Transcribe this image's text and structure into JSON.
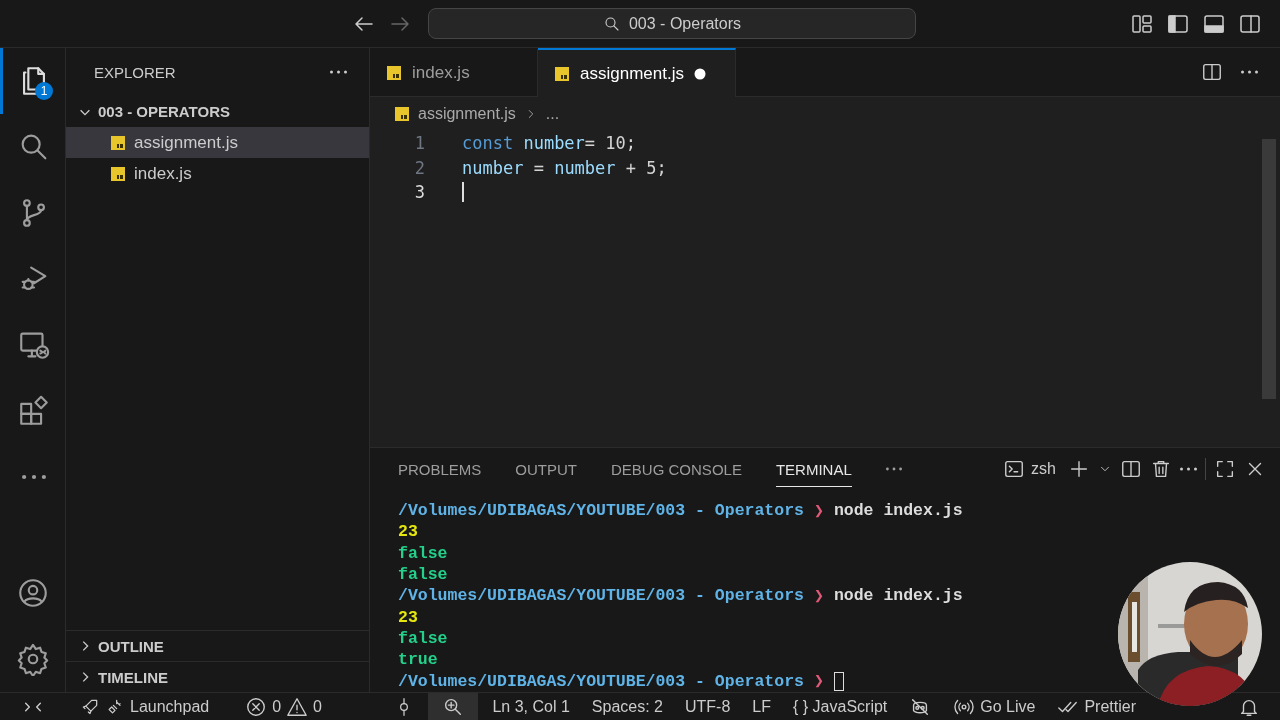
{
  "title_bar": {
    "search": "003 - Operators"
  },
  "activity_bar": {
    "items": [
      {
        "kind": "explorer",
        "selected": true,
        "badge": "1"
      },
      {
        "kind": "search",
        "selected": false
      },
      {
        "kind": "source-control",
        "selected": false
      },
      {
        "kind": "run-debug",
        "selected": false
      },
      {
        "kind": "remote",
        "selected": false
      },
      {
        "kind": "extensions",
        "selected": false
      },
      {
        "kind": "more",
        "selected": false
      }
    ],
    "bottom": [
      {
        "kind": "account"
      },
      {
        "kind": "settings"
      }
    ]
  },
  "sidebar": {
    "title": "EXPLORER",
    "folder": {
      "label": "003 - OPERATORS",
      "expanded": true,
      "children": [
        {
          "label": "assignment.js",
          "selected": true
        },
        {
          "label": "index.js",
          "selected": false
        }
      ]
    },
    "sections": [
      {
        "label": "OUTLINE",
        "expanded": false
      },
      {
        "label": "TIMELINE",
        "expanded": false
      }
    ]
  },
  "editor": {
    "tabs": [
      {
        "label": "index.js",
        "selected": false,
        "modified": false
      },
      {
        "label": "assignment.js",
        "selected": true,
        "modified": true
      }
    ],
    "breadcrumb": [
      "assignment.js",
      "..."
    ],
    "lines": [
      {
        "number": "1",
        "current": false,
        "cursor": false,
        "tokens": [
          {
            "kind": "keyword",
            "text": "const "
          },
          {
            "kind": "variable",
            "text": "number"
          },
          {
            "kind": "plain",
            "text": "= 10;"
          }
        ]
      },
      {
        "number": "2",
        "current": false,
        "cursor": false,
        "tokens": [
          {
            "kind": "variable",
            "text": "number"
          },
          {
            "kind": "plain",
            "text": " = "
          },
          {
            "kind": "variable",
            "text": "number"
          },
          {
            "kind": "plain",
            "text": " + 5;"
          }
        ]
      },
      {
        "number": "3",
        "current": true,
        "cursor": true
      }
    ]
  },
  "panel": {
    "tabs": [
      {
        "label": "PROBLEMS",
        "selected": false
      },
      {
        "label": "OUTPUT",
        "selected": false
      },
      {
        "label": "DEBUG CONSOLE",
        "selected": false
      },
      {
        "label": "TERMINAL",
        "selected": true
      }
    ],
    "shell": "zsh",
    "terminal": [
      {
        "kind": "prompt",
        "path": "/Volumes/UDIBAGAS/YOUTUBE/003 - Operators",
        "symbol": "❯",
        "command": "node index.js",
        "cursor": false
      },
      {
        "kind": "number",
        "text": "23"
      },
      {
        "kind": "boolean",
        "text": "false"
      },
      {
        "kind": "boolean",
        "text": "false"
      },
      {
        "kind": "prompt",
        "path": "/Volumes/UDIBAGAS/YOUTUBE/003 - Operators",
        "symbol": "❯",
        "command": "node index.js",
        "cursor": false
      },
      {
        "kind": "number",
        "text": "23"
      },
      {
        "kind": "boolean",
        "text": "false"
      },
      {
        "kind": "boolean",
        "text": "true"
      },
      {
        "kind": "prompt",
        "path": "/Volumes/UDIBAGAS/YOUTUBE/003 - Operators",
        "symbol": "❯",
        "cursor": true
      }
    ]
  },
  "status_bar": {
    "left": [
      {
        "kind": "remote"
      },
      {
        "kind": "launchpad",
        "text": "Launchpad"
      },
      {
        "kind": "problems",
        "errors": "0",
        "warnings": "0"
      }
    ],
    "right": [
      {
        "kind": "commit"
      },
      {
        "kind": "zoom"
      },
      {
        "kind": "text",
        "text": "Ln 3, Col 1"
      },
      {
        "kind": "text",
        "text": "Spaces: 2"
      },
      {
        "kind": "text",
        "text": "UTF-8"
      },
      {
        "kind": "text",
        "text": "LF"
      },
      {
        "kind": "language",
        "braces": "{ }",
        "text": "JavaScript"
      },
      {
        "kind": "copilot"
      },
      {
        "kind": "golive",
        "text": "Go Live"
      },
      {
        "kind": "prettier",
        "text": "Prettier"
      },
      {
        "kind": "bell"
      }
    ]
  }
}
